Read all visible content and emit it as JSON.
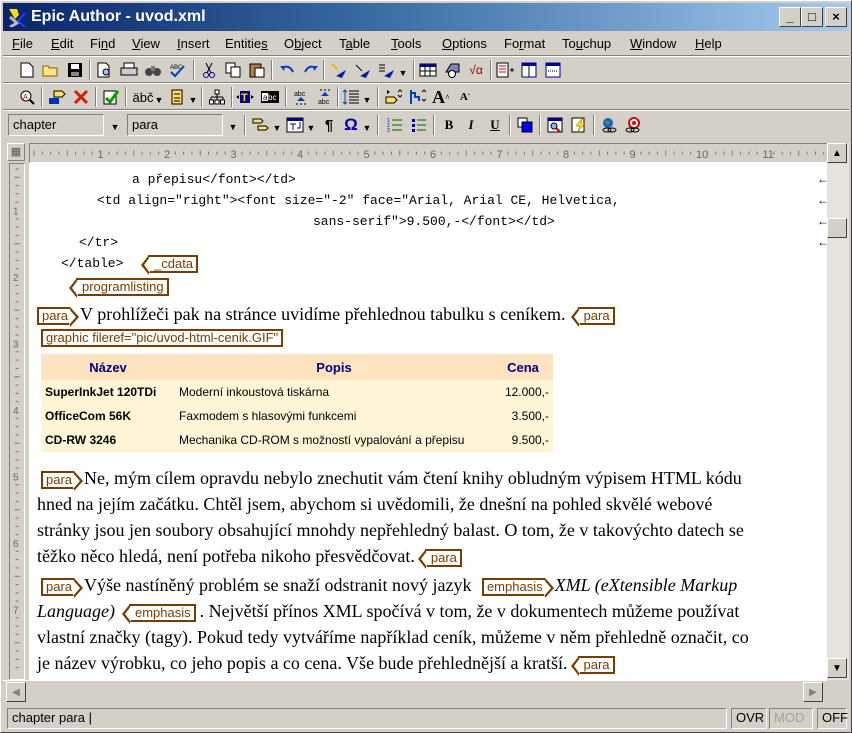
{
  "window": {
    "title": "Epic Author - uvod.xml",
    "controls": {
      "minimize": "_",
      "maximize": "□",
      "close": "×"
    }
  },
  "menubar": {
    "items": [
      {
        "label": "File",
        "accel": "F"
      },
      {
        "label": "Edit",
        "accel": "E"
      },
      {
        "label": "Find",
        "accel": "n"
      },
      {
        "label": "View",
        "accel": "V"
      },
      {
        "label": "Insert",
        "accel": "I"
      },
      {
        "label": "Entities",
        "accel": "s"
      },
      {
        "label": "Object",
        "accel": "b"
      },
      {
        "label": "Table",
        "accel": "a"
      },
      {
        "label": "Tools",
        "accel": "T"
      },
      {
        "label": "Options",
        "accel": "O"
      },
      {
        "label": "Format",
        "accel": "r"
      },
      {
        "label": "Touchup",
        "accel": "u"
      },
      {
        "label": "Window",
        "accel": "W"
      },
      {
        "label": "Help",
        "accel": "H"
      }
    ]
  },
  "toolbar1": {
    "icons": [
      "new-document-icon",
      "open-folder-icon",
      "save-icon",
      "print-preview-icon",
      "print-icon",
      "find-binoculars-icon",
      "spellcheck-icon",
      "cut-icon",
      "copy-icon",
      "paste-icon",
      "undo-icon",
      "redo-icon",
      "insert-markup-icon",
      "change-markup-icon",
      "markup-dropdown-icon",
      "table-icon",
      "object-icon",
      "equation-icon",
      "insert-list-icon",
      "split-vertical-icon",
      "split-horizontal-icon"
    ]
  },
  "toolbar2": {
    "icons": [
      "find-element-icon",
      "tag-icon",
      "delete-tag-icon",
      "validate-check-icon",
      "entity-icon",
      "fragment-icon",
      "tree-structure-icon",
      "text-insert-icon",
      "abc-box-icon",
      "join-icon",
      "split-icon",
      "line-spacing-icon",
      "indent-icon",
      "outdent-icon",
      "font-larger-icon",
      "font-smaller-icon"
    ],
    "entity_label": "äbč"
  },
  "toolbar3": {
    "element_context": "chapter",
    "element_current": "para",
    "icons": [
      "tag-view-icon",
      "text-view-icon",
      "pilcrow-icon",
      "omega-symbol-icon",
      "numbered-list-icon",
      "bullet-list-icon",
      "bold-icon",
      "italic-icon",
      "underline-icon",
      "color-icon",
      "preview-icon",
      "lightning-icon",
      "web-link-icon",
      "target-link-icon"
    ],
    "bold": "B",
    "italic": "I",
    "underline": "U",
    "pilcrow": "¶",
    "omega": "Ω"
  },
  "ruler": {
    "numbers": [
      "1",
      "2",
      "3",
      "4",
      "5",
      "6",
      "7",
      "8",
      "9",
      "10",
      "11",
      "1"
    ]
  },
  "vruler": {
    "numbers": [
      "1",
      "2",
      "3",
      "4",
      "5",
      "6",
      "7"
    ]
  },
  "document": {
    "code_lines": [
      "a přepisu</font></td>",
      "<td align=\"right\"><font size=\"-2\" face=\"Arial, Arial CE, Helvetica,",
      "sans-serif\">9.500,-</font></td>",
      "</tr>",
      "</table>"
    ],
    "return_glyph": "←",
    "tags": {
      "cdata": "_cdata",
      "programlisting": "programlisting",
      "para": "para",
      "graphic": "graphic fileref=\"pic/uvod-html-cenik.GIF\"",
      "emphasis": "emphasis"
    },
    "para1": "V prohlížeči pak na stránce uvidíme přehlednou tabulku s ceníkem.",
    "price_table": {
      "headers": [
        "Název",
        "Popis",
        "Cena"
      ],
      "rows": [
        [
          "SuperInkJet 120TDi",
          "Moderní inkoustová tiskárna",
          "12.000,-"
        ],
        [
          "OfficeCom 56K",
          "Faxmodem s hlasovými funkcemi",
          "3.500,-"
        ],
        [
          "CD-RW 3246",
          "Mechanika CD-ROM s možností vypalování a přepisu",
          "9.500,-"
        ]
      ]
    },
    "para2": [
      "Ne, mým cílem opravdu nebylo znechutit vám čtení knihy obludným výpisem HTML kódu",
      "hned na jejím začátku. Chtěl jsem, abychom si uvědomili, že dnešní na pohled skvělé webové",
      "stránky jsou jen soubory obsahující mnohdy nepřehledný balast. O tom, že v takovýchto datech se",
      "těžko něco hledá, není potřeba nikoho přesvědčovat."
    ],
    "para3": {
      "lead": "Výše nastíněný problém se snaží odstranit nový jazyk",
      "emph1": "XML (eXtensible Markup",
      "emph2": "Language)",
      "rest1": ". Největší přínos XML spočívá v tom, že v dokumentech můžeme používat",
      "rest2": "vlastní značky (tagy). Pokud tedy vytváříme například ceník, můžeme v něm přehledně označit, co",
      "rest3": "je název výrobku, co jeho popis a co cena. Vše bude přehlednější a kratší."
    }
  },
  "statusbar": {
    "context": "chapter para |",
    "ovr": "OVR",
    "mod": "MOD",
    "off": "OFF"
  }
}
